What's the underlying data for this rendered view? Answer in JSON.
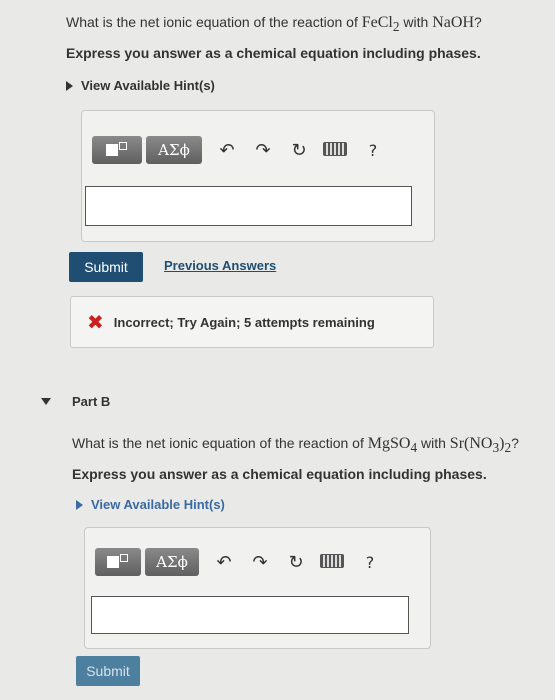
{
  "partA": {
    "question_prefix": "What is the net ionic equation of the reaction of ",
    "reactant1": "FeCl",
    "reactant1_sub": "2",
    "connector": " with ",
    "reactant2": "NaOH",
    "question_suffix": "?",
    "instruction": "Express you answer as a chemical equation including phases.",
    "hint_label": "View Available Hint(s)",
    "toolbar": {
      "greek_label": "ΑΣϕ",
      "help_label": "?"
    },
    "answer_value": "",
    "submit_label": "Submit",
    "previous_answers_label": "Previous Answers",
    "feedback": "Incorrect; Try Again; 5 attempts remaining"
  },
  "partB": {
    "label": "Part B",
    "question_prefix": "What is the net ionic equation of the reaction of ",
    "reactant1": "MgSO",
    "reactant1_sub": "4",
    "connector": " with ",
    "reactant2_a": "Sr(NO",
    "reactant2_sub_a": "3",
    "reactant2_b": ")",
    "reactant2_sub_b": "2",
    "question_suffix": "?",
    "instruction": "Express you answer as a chemical equation including phases.",
    "hint_label": "View Available Hint(s)",
    "toolbar": {
      "greek_label": "ΑΣϕ",
      "help_label": "?"
    },
    "answer_value": "",
    "submit_label": "Submit"
  },
  "colors": {
    "submit": "#1f4e72",
    "error": "#c92020",
    "link": "#1f4e72"
  }
}
